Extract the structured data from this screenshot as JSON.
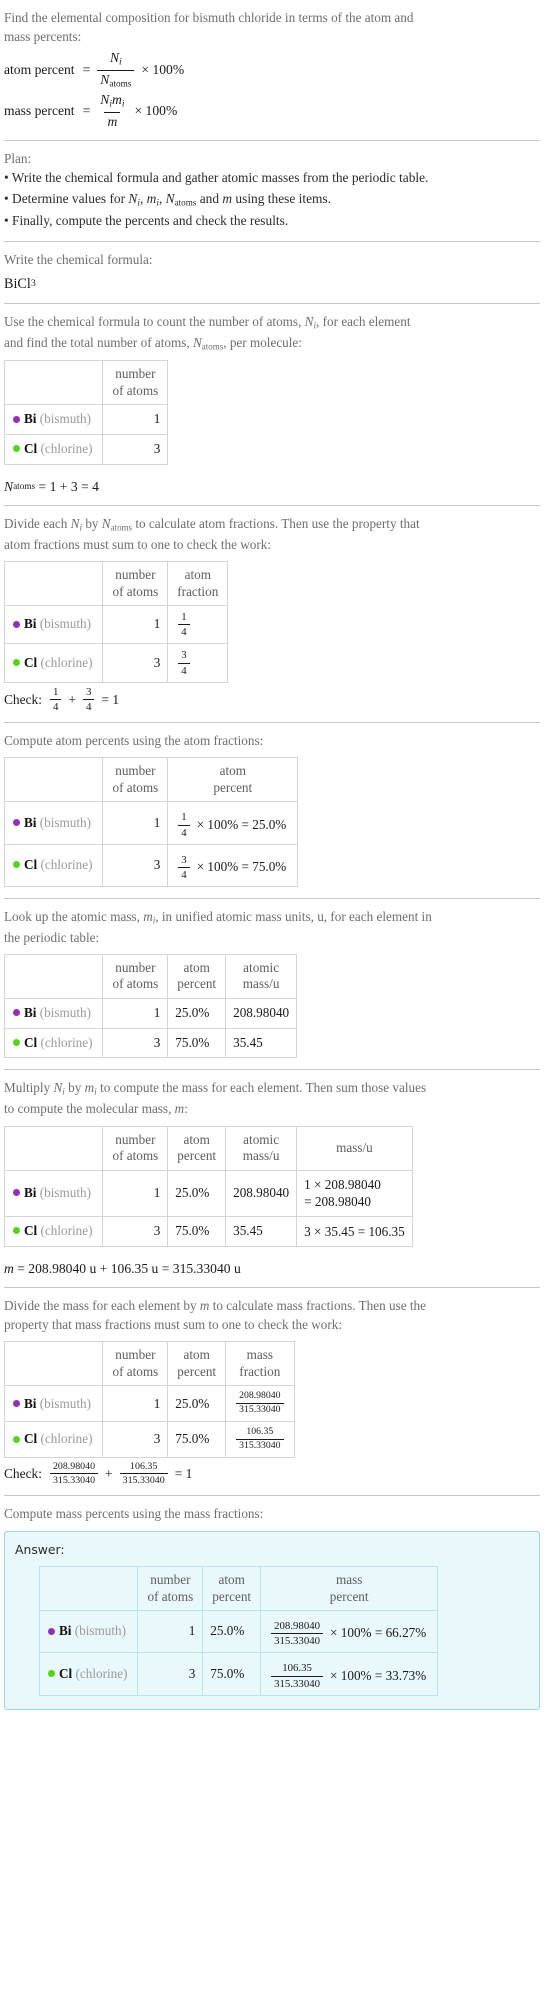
{
  "doc": {
    "title_line1": "Find the elemental composition for bismuth chloride in terms of the atom and",
    "title_line2": "mass percents:",
    "atom_percent_label": "atom percent",
    "equals": "=",
    "times100": "× 100%",
    "mass_percent_label": "mass percent",
    "Ni": "N",
    "i": "i",
    "Natoms_base": "N",
    "atoms_sub": "atoms",
    "mi": "m",
    "m": "m"
  },
  "plan": {
    "heading": "Plan:",
    "items": [
      "• Write the chemical formula and gather atomic masses from the periodic table.",
      "• Determine values for ",
      "• Finally, compute the percents and check the results."
    ],
    "item2_tail": " and ",
    "item2_end": " using these items."
  },
  "formula_step": {
    "prompt": "Write the chemical formula:",
    "formula_base": "BiCl",
    "formula_sub": "3"
  },
  "count_step": {
    "prompt_line1": "Use the chemical formula to count the number of atoms, ",
    "prompt_line1_tail": ", for each element",
    "prompt_line2": "and find the total number of atoms, ",
    "prompt_line2_tail": ", per molecule:",
    "header_col1_line1": "number",
    "header_col1_line2": "of atoms",
    "rows": [
      {
        "symbol": "Bi",
        "name": "(bismuth)",
        "color": "#9130b8",
        "atoms": "1"
      },
      {
        "symbol": "Cl",
        "name": "(chlorine)",
        "color": "#59d11c",
        "atoms": "3"
      }
    ],
    "total_line": "= 1 + 3 = 4"
  },
  "fraction_step": {
    "prompt_line1": "Divide each ",
    "prompt_line1_mid": " by ",
    "prompt_line1_tail": " to calculate atom fractions. Then use the property that",
    "prompt_line2": "atom fractions must sum to one to check the work:",
    "headers": [
      {
        "l1": "number",
        "l2": "of atoms"
      },
      {
        "l1": "atom",
        "l2": "fraction"
      }
    ],
    "rows": [
      {
        "symbol": "Bi",
        "name": "(bismuth)",
        "color": "#9130b8",
        "atoms": "1",
        "num": "1",
        "den": "4"
      },
      {
        "symbol": "Cl",
        "name": "(chlorine)",
        "color": "#59d11c",
        "atoms": "3",
        "num": "3",
        "den": "4"
      }
    ],
    "check_label": "Check:",
    "check_plus": "+",
    "check_eq": "= 1"
  },
  "atom_percent_step": {
    "prompt": "Compute atom percents using the atom fractions:",
    "headers": [
      {
        "l1": "number",
        "l2": "of atoms"
      },
      {
        "l1": "atom",
        "l2": "percent"
      }
    ],
    "rows": [
      {
        "symbol": "Bi",
        "name": "(bismuth)",
        "color": "#9130b8",
        "atoms": "1",
        "num": "1",
        "den": "4",
        "expr": "× 100% = 25.0%"
      },
      {
        "symbol": "Cl",
        "name": "(chlorine)",
        "color": "#59d11c",
        "atoms": "3",
        "num": "3",
        "den": "4",
        "expr": "× 100% = 75.0%"
      }
    ]
  },
  "mass_lookup_step": {
    "prompt_line1": "Look up the atomic mass, ",
    "prompt_line1_tail": ", in unified atomic mass units, u, for each element in",
    "prompt_line2": "the periodic table:",
    "headers": [
      {
        "l1": "number",
        "l2": "of atoms"
      },
      {
        "l1": "atom",
        "l2": "percent"
      },
      {
        "l1": "atomic",
        "l2": "mass/u"
      }
    ],
    "rows": [
      {
        "symbol": "Bi",
        "name": "(bismuth)",
        "color": "#9130b8",
        "atoms": "1",
        "percent": "25.0%",
        "mass": "208.98040"
      },
      {
        "symbol": "Cl",
        "name": "(chlorine)",
        "color": "#59d11c",
        "atoms": "3",
        "percent": "75.0%",
        "mass": "35.45"
      }
    ]
  },
  "multiply_step": {
    "prompt_line1": "Multiply ",
    "prompt_line1_mid": " by ",
    "prompt_line1_tail": " to compute the mass for each element. Then sum those values",
    "prompt_line2": "to compute the molecular mass, ",
    "prompt_line2_tail": ":",
    "headers": [
      {
        "l1": "number",
        "l2": "of atoms"
      },
      {
        "l1": "atom",
        "l2": "percent"
      },
      {
        "l1": "atomic",
        "l2": "mass/u"
      },
      {
        "l1": "mass/u",
        "l2": ""
      }
    ],
    "rows": [
      {
        "symbol": "Bi",
        "name": "(bismuth)",
        "color": "#9130b8",
        "atoms": "1",
        "percent": "25.0%",
        "mass": "208.98040",
        "calc_l1": "1 × 208.98040",
        "calc_l2": "= 208.98040"
      },
      {
        "symbol": "Cl",
        "name": "(chlorine)",
        "color": "#59d11c",
        "atoms": "3",
        "percent": "75.0%",
        "mass": "35.45",
        "calc_l1": "3 × 35.45 = 106.35",
        "calc_l2": ""
      }
    ],
    "total": "= 208.98040 u + 106.35 u = 315.33040 u"
  },
  "mass_fraction_step": {
    "prompt_line1": "Divide the mass for each element by ",
    "prompt_line1_tail": " to calculate mass fractions. Then use the",
    "prompt_line2": "property that mass fractions must sum to one to check the work:",
    "headers": [
      {
        "l1": "number",
        "l2": "of atoms"
      },
      {
        "l1": "atom",
        "l2": "percent"
      },
      {
        "l1": "mass",
        "l2": "fraction"
      }
    ],
    "rows": [
      {
        "symbol": "Bi",
        "name": "(bismuth)",
        "color": "#9130b8",
        "atoms": "1",
        "percent": "25.0%",
        "num": "208.98040",
        "den": "315.33040"
      },
      {
        "symbol": "Cl",
        "name": "(chlorine)",
        "color": "#59d11c",
        "atoms": "3",
        "percent": "75.0%",
        "num": "106.35",
        "den": "315.33040"
      }
    ],
    "check_label": "Check:",
    "check_plus": "+",
    "check_eq": "= 1",
    "check_f1_num": "208.98040",
    "check_f1_den": "315.33040",
    "check_f2_num": "106.35",
    "check_f2_den": "315.33040"
  },
  "answer_step": {
    "prompt": "Compute mass percents using the mass fractions:",
    "answer_label": "Answer:",
    "headers": [
      {
        "l1": "number",
        "l2": "of atoms"
      },
      {
        "l1": "atom",
        "l2": "percent"
      },
      {
        "l1": "mass",
        "l2": "percent"
      }
    ],
    "rows": [
      {
        "symbol": "Bi",
        "name": "(bismuth)",
        "color": "#9130b8",
        "atoms": "1",
        "percent": "25.0%",
        "num": "208.98040",
        "den": "315.33040",
        "expr": "× 100% = 66.27%"
      },
      {
        "symbol": "Cl",
        "name": "(chlorine)",
        "color": "#59d11c",
        "atoms": "3",
        "percent": "75.0%",
        "num": "106.35",
        "den": "315.33040",
        "expr": "× 100% = 33.73%"
      }
    ]
  },
  "chart_data": {
    "type": "table",
    "title": "Elemental composition of bismuth chloride (BiCl3)",
    "categories": [
      "Bi (bismuth)",
      "Cl (chlorine)"
    ],
    "series": [
      {
        "name": "number of atoms",
        "values": [
          1,
          3
        ]
      },
      {
        "name": "atom percent",
        "values": [
          25.0,
          75.0
        ]
      },
      {
        "name": "atomic mass/u",
        "values": [
          208.9804,
          35.45
        ]
      },
      {
        "name": "mass/u",
        "values": [
          208.9804,
          106.35
        ]
      },
      {
        "name": "mass percent",
        "values": [
          66.27,
          33.73
        ]
      }
    ],
    "N_atoms_total": 4,
    "molecular_mass_u": 315.3304
  }
}
